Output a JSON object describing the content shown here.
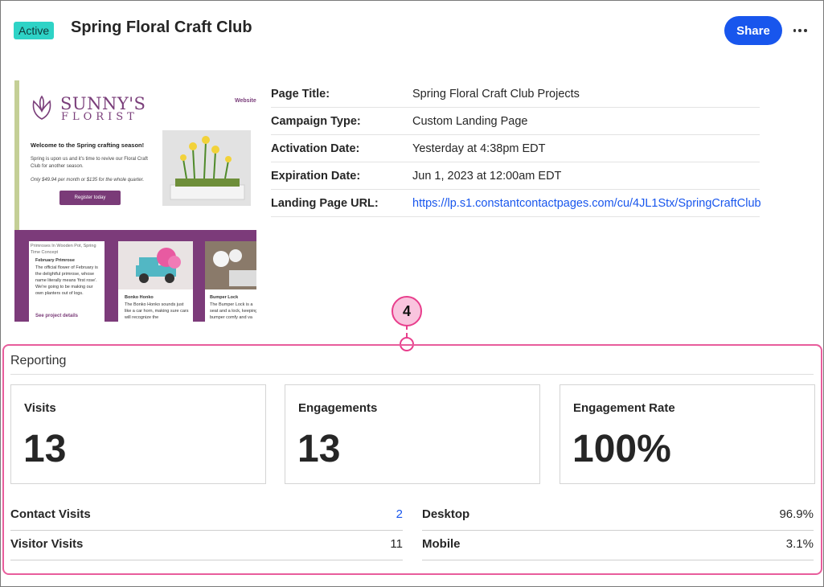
{
  "header": {
    "status_badge": "Active",
    "title": "Spring Floral Craft Club",
    "share_label": "Share"
  },
  "preview": {
    "brand_line1": "SUNNY'S",
    "brand_line2": "FLORIST",
    "nav_link": "Website",
    "welcome_heading": "Welcome to the Spring crafting season!",
    "body_text": "Spring is upon us and it's time to revive our Floral Craft Club for another season.",
    "price_text": "Only $49.94 per month or $135 for the whole quarter.",
    "cta_label": "Register today",
    "card1": {
      "image_alt": "Primroses In Wooden Pot, Spring Time Concept",
      "title": "February Primrose",
      "text": "The official flower of February is the delightful primrose, whose name literally means 'first rose'. We're going to be making our own planters out of logs.",
      "link": "See project details"
    },
    "card2": {
      "title": "Bonko Honko",
      "text": "The Bonko Honko sounds just like a car horn, making sure cars will recognize the"
    },
    "card3": {
      "title": "Bumper Lock",
      "text": "The Bumper Lock is a seat and a lock, keeping bumper comfy and va"
    }
  },
  "details": [
    {
      "label": "Page Title:",
      "value": "Spring Floral Craft Club Projects"
    },
    {
      "label": "Campaign Type:",
      "value": "Custom Landing Page"
    },
    {
      "label": "Activation Date:",
      "value": "Yesterday at 4:38pm EDT"
    },
    {
      "label": "Expiration Date:",
      "value": "Jun 1, 2023 at 12:00am EDT"
    },
    {
      "label": "Landing Page URL:",
      "value": "https://lp.s1.constantcontactpages.com/cu/4JL1Stx/SpringCraftClub"
    }
  ],
  "callout": {
    "number": "4"
  },
  "reporting": {
    "title": "Reporting",
    "stats": [
      {
        "label": "Visits",
        "value": "13"
      },
      {
        "label": "Engagements",
        "value": "13"
      },
      {
        "label": "Engagement Rate",
        "value": "100%"
      }
    ],
    "visits_breakdown": [
      {
        "label": "Contact Visits",
        "value": "2"
      },
      {
        "label": "Visitor Visits",
        "value": "11"
      }
    ],
    "device_breakdown": [
      {
        "label": "Desktop",
        "value": "96.9%"
      },
      {
        "label": "Mobile",
        "value": "3.1%"
      }
    ]
  },
  "colors": {
    "accent": "#1856ed",
    "badge": "#2ed3c6",
    "callout": "#e83e8c",
    "brand_purple": "#7a3b78"
  }
}
